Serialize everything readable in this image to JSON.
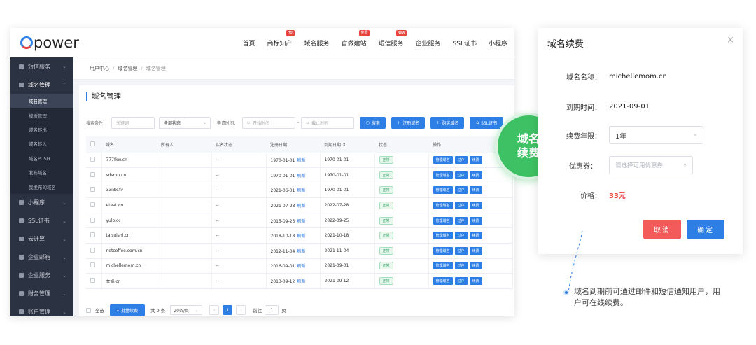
{
  "brand": {
    "logo_text": "power",
    "accent": "#2d7fe6",
    "badge_red": "#e8453c"
  },
  "nav": [
    {
      "label": "首页",
      "badge": ""
    },
    {
      "label": "商标知产",
      "badge": "Hot"
    },
    {
      "label": "域名服务",
      "badge": ""
    },
    {
      "label": "官微建站",
      "badge": "免费"
    },
    {
      "label": "短信服务",
      "badge": "New"
    },
    {
      "label": "企业服务",
      "badge": ""
    },
    {
      "label": "SSL证书",
      "badge": ""
    },
    {
      "label": "小程序",
      "badge": ""
    }
  ],
  "sidebar": {
    "group_sms": "短信服务",
    "group_domain": "域名管理",
    "sub_items": [
      "域名管理",
      "模板管理",
      "域名转出",
      "域名转入",
      "域名PUSH",
      "发布域名",
      "我发布的域名"
    ],
    "groups_after": [
      "小程序",
      "SSL证书",
      "云计算",
      "企业邮箱",
      "企业服务",
      "财务管理",
      "账户管理"
    ]
  },
  "breadcrumb": {
    "home": "用户中心",
    "level1": "域名管理",
    "current": "域名管理"
  },
  "page_title": "域名管理",
  "filters": {
    "search_label": "搜索条件：",
    "keyword_placeholder": "关键词",
    "status_value": "全部状态",
    "date_label": "申请时间：",
    "start_placeholder": "开始时间",
    "end_placeholder": "截止时间",
    "dash": "-",
    "btn_search": "搜索",
    "btn_register": "注册域名",
    "btn_buy": "购买域名",
    "btn_ssl": "SSL证书"
  },
  "table": {
    "columns": [
      "域名",
      "所有人",
      "实名状态",
      "注册日期",
      "到期日期",
      "状态",
      "操作"
    ],
    "sort_mark": "⇕",
    "refresh_label": "刷新",
    "ops": [
      "管理域名",
      "过户",
      "续费"
    ],
    "rows": [
      {
        "domain": "777fkw.cn",
        "owner": "",
        "realname": "--",
        "reg": "1970-01-01",
        "exp": "1970-01-01",
        "status": "正常"
      },
      {
        "domain": "sdsmu.cn",
        "owner": "",
        "realname": "--",
        "reg": "1970-01-01",
        "exp": "1970-01-01",
        "status": "正常"
      },
      {
        "domain": "33i3x.tv",
        "owner": "",
        "realname": "--",
        "reg": "2021-06-01",
        "exp": "1970-01-01",
        "status": "正常"
      },
      {
        "domain": "eteat.co",
        "owner": "",
        "realname": "--",
        "reg": "2021-07-28",
        "exp": "2022-07-28",
        "status": "正常"
      },
      {
        "domain": "yulo.cc",
        "owner": "",
        "realname": "--",
        "reg": "2015-09-25",
        "exp": "2022-09-25",
        "status": "正常"
      },
      {
        "domain": "taisuishi.cn",
        "owner": "",
        "realname": "--",
        "reg": "2018-10-18",
        "exp": "2021-10-18",
        "status": "正常"
      },
      {
        "domain": "netcoffee.com.cn",
        "owner": "",
        "realname": "--",
        "reg": "2012-11-04",
        "exp": "2021-11-04",
        "status": "正常"
      },
      {
        "domain": "michellemom.cn",
        "owner": "",
        "realname": "--",
        "reg": "2016-09-01",
        "exp": "2021-09-01",
        "status": "正常"
      },
      {
        "domain": "女娲.cn",
        "owner": "",
        "realname": "--",
        "reg": "2013-09-12",
        "exp": "2021-09-12",
        "status": "正常"
      }
    ]
  },
  "footer": {
    "select_all": "全选",
    "batch_renew": "批量续费",
    "total": "共 9 条",
    "page_size": "20条/页",
    "prev": "‹",
    "page": "1",
    "next": "›",
    "goto": "前往",
    "goto_value": "1",
    "goto_unit": "页"
  },
  "badge": {
    "line1": "域名",
    "line2": "续费"
  },
  "dialog": {
    "title": "域名续费",
    "close": "×",
    "domain_label": "域名名称：",
    "domain_value": "michellemom.cn",
    "expire_label": "到期时间：",
    "expire_value": "2021-09-01",
    "years_label": "续费年限：",
    "years_value": "1年",
    "coupon_label": "优惠券：",
    "coupon_placeholder": "请选择可用优惠券",
    "price_label": "价格：",
    "price_value": "33元",
    "cancel": "取消",
    "confirm": "确定"
  },
  "note": "域名到期前可通过邮件和短信通知用户，用户可在线续费。"
}
